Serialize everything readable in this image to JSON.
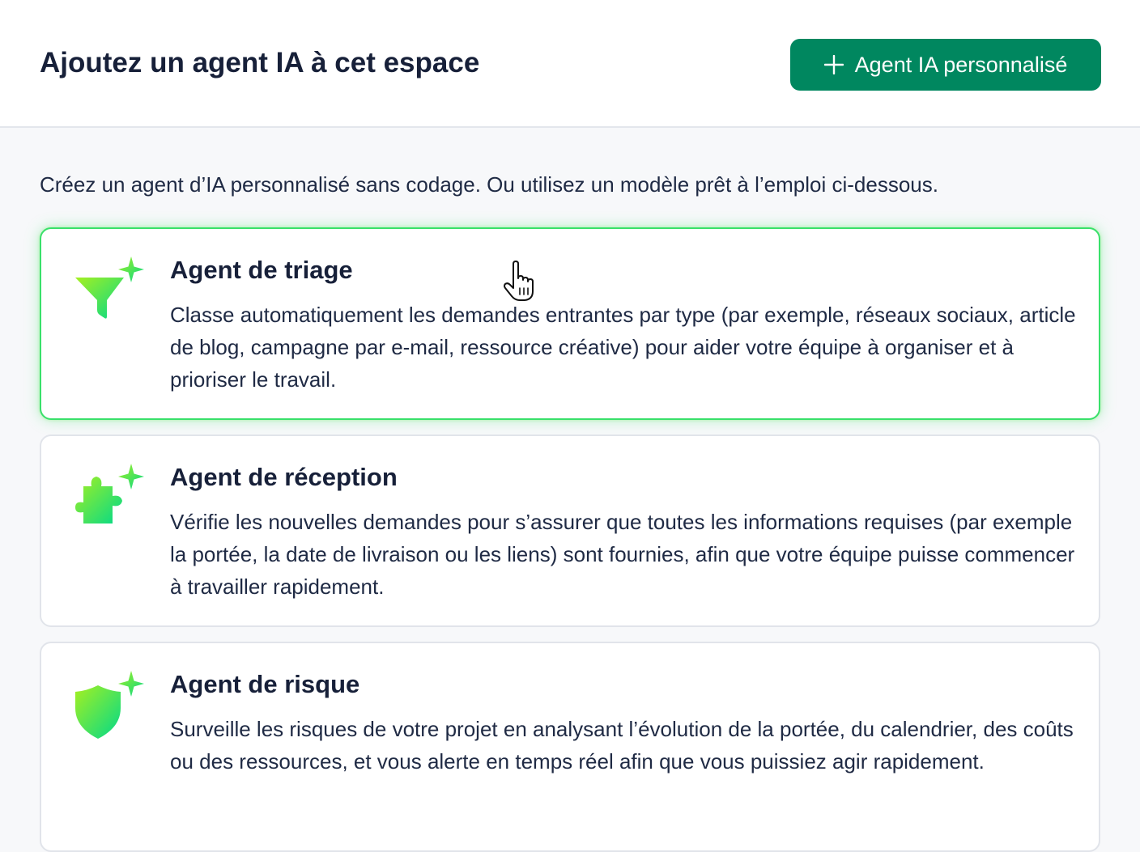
{
  "header": {
    "title": "Ajoutez un agent IA à cet espace",
    "add_button_label": "Agent IA personnalisé"
  },
  "intro_text": "Créez un agent d’IA personnalisé sans codage. Ou utilisez un modèle prêt à l’emploi ci-dessous.",
  "agents": [
    {
      "title": "Agent de triage",
      "description": "Classe automatiquement les demandes entrantes par type (par exemple, réseaux sociaux, article de blog, campagne par e-mail, ressource créative) pour aider votre équipe à organiser et à prioriser le travail.",
      "icon": "funnel-sparkle-icon",
      "state": "hovered"
    },
    {
      "title": "Agent de réception",
      "description": "Vérifie les nouvelles demandes pour s’assurer que toutes les informations requises (par exemple la portée, la date de livraison ou les liens) sont fournies, afin que votre équipe puisse commencer à travailler rapidement.",
      "icon": "puzzle-sparkle-icon",
      "state": "default"
    },
    {
      "title": "Agent de risque",
      "description": "Surveille les risques de votre projet en analysant l’évolution de la portée, du calendrier, des coûts ou des ressources, et vous alerte en temps réel afin que vous puissiez agir rapidement.",
      "icon": "shield-sparkle-icon",
      "state": "default"
    }
  ],
  "colors": {
    "primary_button": "#00875f",
    "icon_gradient_start": "#a6f020",
    "icon_gradient_end": "#00d98a",
    "active_border": "#39e06a",
    "text": "#172039",
    "background": "#f7f8fa"
  }
}
